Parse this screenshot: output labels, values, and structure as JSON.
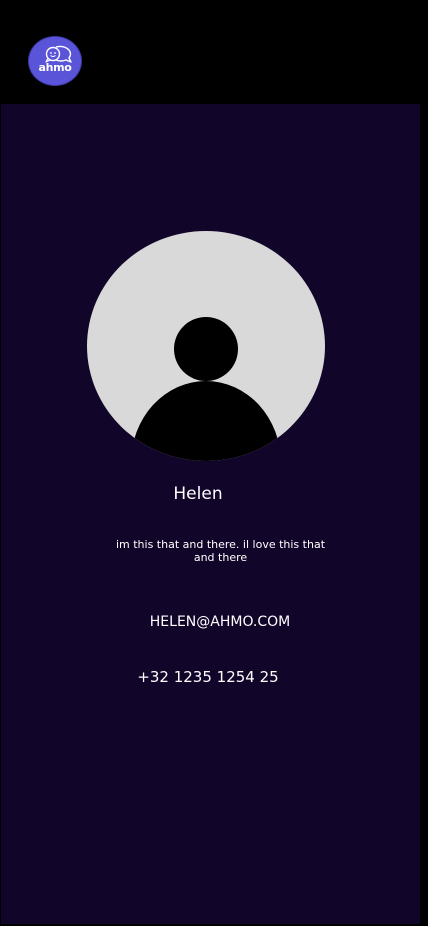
{
  "header": {
    "logo_text": "ahmo",
    "logo_icon": "chat-bubbles-smile-icon"
  },
  "profile": {
    "avatar_icon": "default-user-avatar",
    "name": "Helen",
    "bio": "im this that and there. il love this that and there",
    "email": "HELEN@AHMO.COM",
    "phone": "+32 1235 1254 25"
  },
  "colors": {
    "background": "#12052a",
    "header_bg": "#000000",
    "logo_bg": "#5a55d8",
    "avatar_bg": "#d9d9d9",
    "avatar_silhouette": "#000000",
    "text": "#ffffff"
  }
}
